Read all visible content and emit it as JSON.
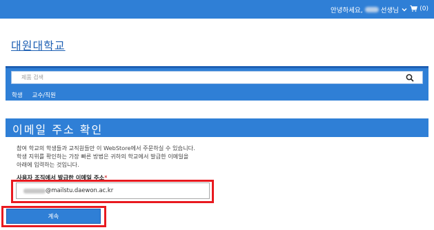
{
  "header": {
    "greeting_prefix": "안녕하세요,",
    "greeting_suffix": "선생님",
    "cart_count": "(0)",
    "colors": {
      "bar": "#2f7fd6",
      "text": "#ffffff"
    }
  },
  "brand": {
    "name": "대원대학교",
    "color": "#1d5fb3"
  },
  "search": {
    "placeholder": "제품 검색",
    "icon": "search-icon"
  },
  "nav": {
    "items": [
      {
        "label": "학생"
      },
      {
        "label": "교수/직원"
      }
    ]
  },
  "verify": {
    "title": "이메일 주소 확인",
    "description_lines": [
      "참여 학교의 학생들과 교직원들만 이 WebStore에서 주문하실 수 있습니다.",
      "학생 지위를 확인하는 가장 빠른 방법은 귀하의 학교에서 발급한 이메일을",
      "아래에 입력하는 것입니다."
    ],
    "field_label": "사용자 조직에서 발급한 이메일 주소",
    "required_mark": "*",
    "email_visible_part": "@mailstu.daewon.ac.kr",
    "continue_label": "계속",
    "highlight_color": "#e8191f"
  }
}
